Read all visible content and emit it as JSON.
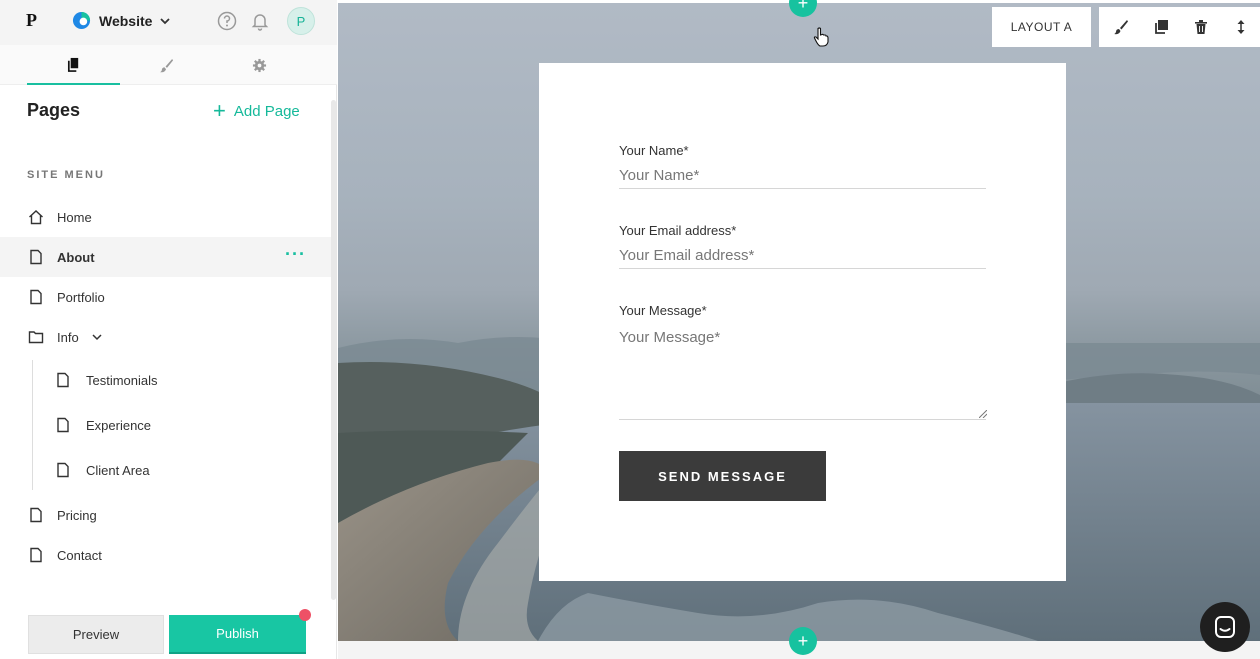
{
  "app": {
    "logo": "P",
    "site_name": "Website",
    "avatar_initial": "P",
    "accent_color": "#18c6a3"
  },
  "sidebar": {
    "tabs": [
      {
        "icon": "pages-icon",
        "active": true
      },
      {
        "icon": "brush-icon",
        "active": false
      },
      {
        "icon": "gear-icon",
        "active": false
      }
    ],
    "title": "Pages",
    "add_page": "Add Page",
    "section_label": "SITE MENU",
    "items": [
      {
        "label": "Home",
        "icon": "home-icon"
      },
      {
        "label": "About",
        "icon": "page-icon",
        "selected": true
      },
      {
        "label": "Portfolio",
        "icon": "page-icon"
      },
      {
        "label": "Info",
        "icon": "folder-icon"
      },
      {
        "label": "Testimonials",
        "icon": "page-icon"
      },
      {
        "label": "Experience",
        "icon": "page-icon"
      },
      {
        "label": "Client Area",
        "icon": "page-icon"
      },
      {
        "label": "Pricing",
        "icon": "page-icon"
      },
      {
        "label": "Contact",
        "icon": "page-icon"
      }
    ],
    "more": "···",
    "preview": "Preview",
    "publish": "Publish"
  },
  "toolbar": {
    "layout_label": "LAYOUT A"
  },
  "form": {
    "name_label": "Your Name*",
    "name_placeholder": "Your Name*",
    "email_label": "Your Email address*",
    "email_placeholder": "Your Email address*",
    "message_label": "Your Message*",
    "message_placeholder": "Your Message*",
    "submit": "SEND MESSAGE"
  },
  "add_section": "+"
}
